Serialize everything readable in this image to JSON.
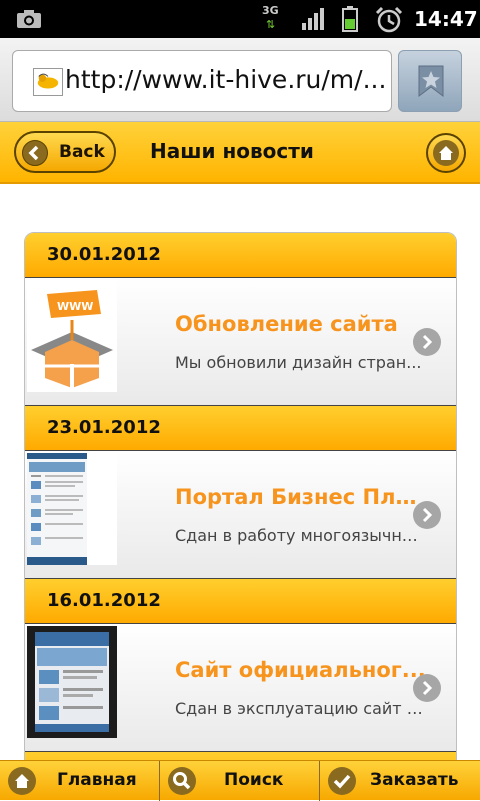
{
  "status_bar": {
    "network": "3G",
    "time": "14:47"
  },
  "browser": {
    "url": "http://www.it-hive.ru/m/..."
  },
  "header": {
    "back_label": "Back",
    "title": "Наши новости"
  },
  "news": [
    {
      "date": "30.01.2012",
      "title": "Обновление сайта",
      "description": "Мы обновили дизайн стран..."
    },
    {
      "date": "23.01.2012",
      "title": "Портал Бизнес Пла...",
      "description": "Сдан в работу многоязычны..."
    },
    {
      "date": "16.01.2012",
      "title": "Сайт официальног...",
      "description": "Сдан в эксплуатацию сайт о..."
    }
  ],
  "toolbar": {
    "home_label": "Главная",
    "search_label": "Поиск",
    "order_label": "Заказать"
  },
  "colors": {
    "accent": "#ffbb00",
    "title_orange": "#f7941d"
  }
}
